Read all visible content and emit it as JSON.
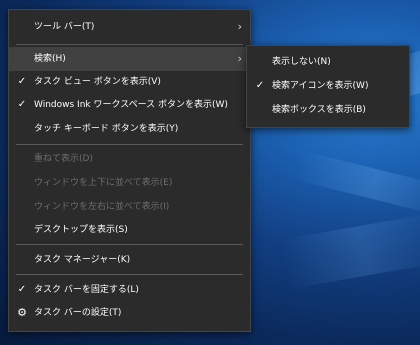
{
  "context_menu": {
    "items": [
      {
        "label": "ツール バー(T)",
        "has_submenu": true
      },
      {
        "label": "検索(H)",
        "has_submenu": true,
        "highlighted": true
      },
      {
        "label": "タスク ビュー ボタンを表示(V)",
        "checked": true
      },
      {
        "label": "Windows Ink ワークスペース ボタンを表示(W)",
        "checked": true
      },
      {
        "label": "タッチ キーボード ボタンを表示(Y)"
      },
      {
        "label": "重ねて表示(D)",
        "disabled": true
      },
      {
        "label": "ウィンドウを上下に並べて表示(E)",
        "disabled": true
      },
      {
        "label": "ウィンドウを左右に並べて表示(I)",
        "disabled": true
      },
      {
        "label": "デスクトップを表示(S)"
      },
      {
        "label": "タスク マネージャー(K)"
      },
      {
        "label": "タスク バーを固定する(L)",
        "checked": true
      },
      {
        "label": "タスク バーの設定(T)",
        "icon": "gear-icon"
      }
    ],
    "check_glyph": "✓",
    "arrow_glyph": "›",
    "gear_glyph": "⚙"
  },
  "search_submenu": {
    "items": [
      {
        "label": "表示しない(N)"
      },
      {
        "label": "検索アイコンを表示(W)",
        "checked": true
      },
      {
        "label": "検索ボックスを表示(B)"
      }
    ]
  },
  "colors": {
    "menu_bg": "#2b2b2b",
    "hover_bg": "#414141",
    "text": "#ffffff",
    "disabled_text": "#6d6d6d",
    "separator": "#5a5a5a"
  }
}
